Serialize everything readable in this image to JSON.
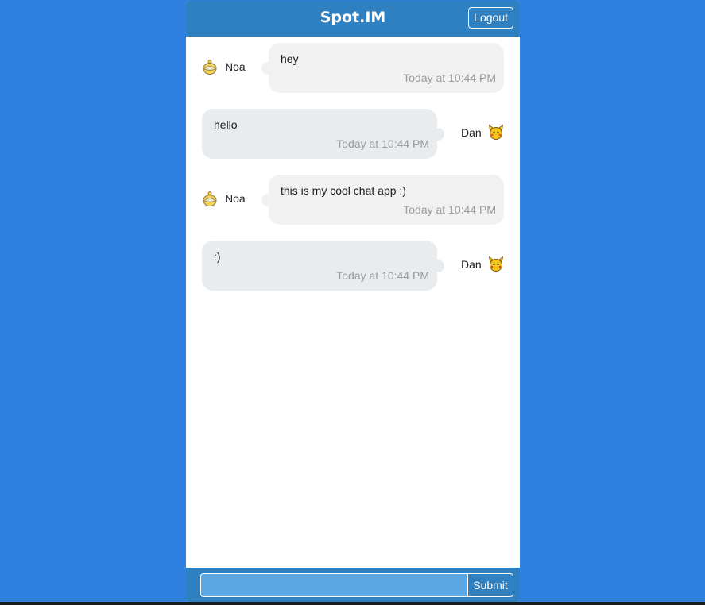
{
  "header": {
    "title": "Spot.IM",
    "logout_label": "Logout"
  },
  "messages": [
    {
      "side": "left",
      "user": "Noa",
      "avatar_icon": "noa-avatar-icon",
      "text": "hey",
      "time": "Today at 10:44 PM"
    },
    {
      "side": "right",
      "user": "Dan",
      "avatar_icon": "dan-avatar-icon",
      "text": "hello",
      "time": "Today at 10:44 PM"
    },
    {
      "side": "left",
      "user": "Noa",
      "avatar_icon": "noa-avatar-icon",
      "text": "this is my cool chat app :)",
      "time": "Today at 10:44 PM"
    },
    {
      "side": "right",
      "user": "Dan",
      "avatar_icon": "dan-avatar-icon",
      "text": ":)",
      "time": "Today at 10:44 PM"
    }
  ],
  "composer": {
    "input_value": "",
    "submit_label": "Submit"
  },
  "colors": {
    "page_background": "#2e7fe0",
    "header_background": "#2f80c0",
    "input_background": "#5aa7e3",
    "bubble_left": "#f1f1f1",
    "bubble_right": "#e8ecef"
  }
}
